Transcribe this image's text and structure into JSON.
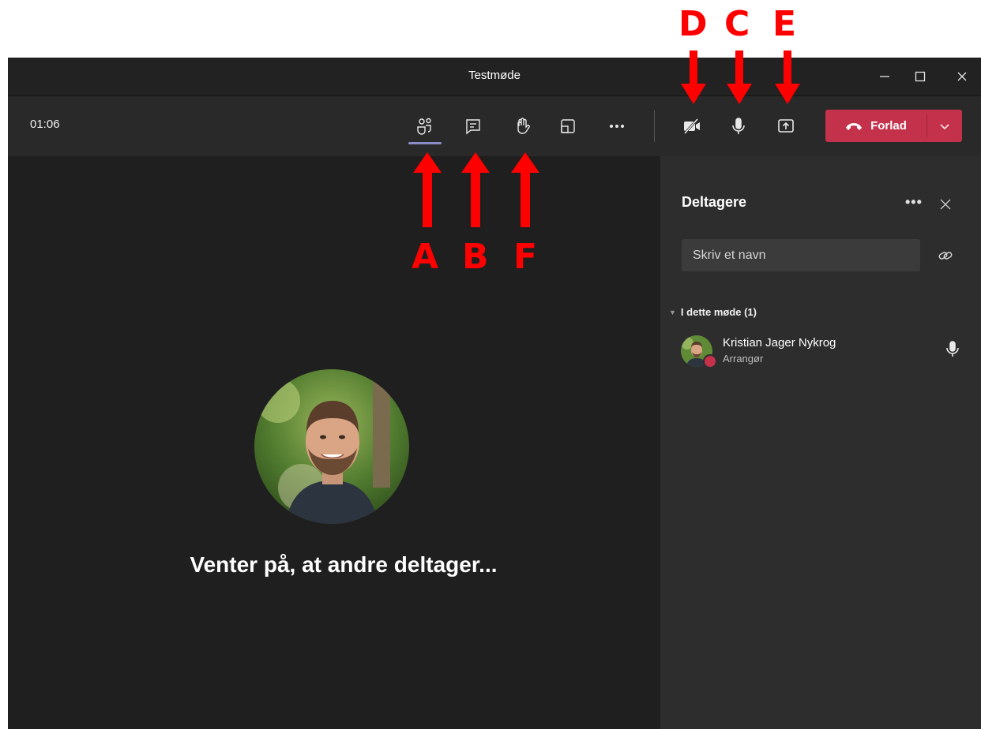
{
  "window": {
    "title": "Testmøde",
    "controls": [
      "minimize-icon",
      "maximize-icon",
      "close-icon"
    ]
  },
  "toolbar": {
    "timer": "01:06",
    "icons": [
      "participants-icon",
      "chat-icon",
      "raise-hand-icon",
      "room-icon",
      "more-icon",
      "camera-off-icon",
      "microphone-icon",
      "share-screen-icon"
    ],
    "leave_label": "Forlad",
    "leave_color": "#c4314b",
    "active_tab_color": "#8b8cc7"
  },
  "stage": {
    "waiting_text": "Venter på, at andre deltager..."
  },
  "panel": {
    "title": "Deltagere",
    "more_label": "•••",
    "search_placeholder": "Skriv et navn",
    "section_label": "I dette møde (1)",
    "participants": [
      {
        "name": "Kristian Jager Nykrog",
        "role": "Arrangør",
        "status_color": "#c4314b"
      }
    ]
  },
  "annotations": {
    "color": "#ff0000",
    "letters": [
      "D",
      "C",
      "E",
      "A",
      "B",
      "F"
    ]
  }
}
